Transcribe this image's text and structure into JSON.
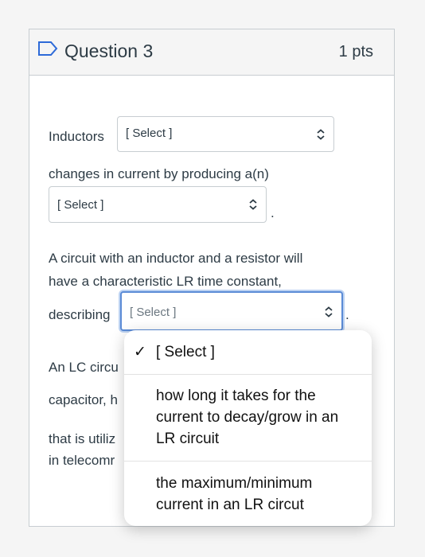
{
  "question": {
    "title": "Question 3",
    "points": "1 pts"
  },
  "text": {
    "inductors": "Inductors",
    "changes": "changes in current by producing a(n)",
    "period1": ".",
    "circuit_line1": "A circuit with an inductor and a resistor will",
    "circuit_line2": "have a characteristic LR time constant,",
    "describing": "describing",
    "period2": ".",
    "lc_partial": "An LC circu",
    "capacitor_partial": "capacitor, h",
    "utilized_partial": "that is utiliz",
    "telecom_partial": "in telecomr"
  },
  "selects": {
    "select1": "[ Select ]",
    "select2": "[ Select ]",
    "select3": "[ Select ]"
  },
  "dropdown": {
    "check_mark": "✓",
    "options": [
      "[ Select ]",
      "how long it takes for the current to decay/grow in an LR circuit",
      "the maximum/minimum current in an LR circut"
    ]
  },
  "colors": {
    "accent": "#5b8bd6",
    "border": "#c7cdd1",
    "text": "#2d3b45"
  }
}
